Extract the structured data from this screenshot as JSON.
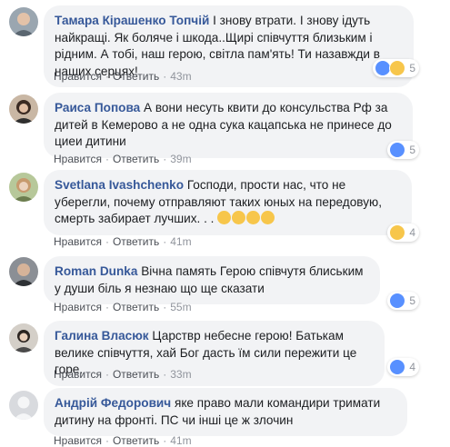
{
  "comments": [
    {
      "author": "Тамара Кірашенко Топчій",
      "text": "І знову втрати. І знову ідуть найкращі. Як боляче і шкода..Щирі співчуття близьким і рідним. А тобі, наш герою, світла пам'ять! Ти назавжди в наших серцях!",
      "like_label": "Нравится",
      "reply_label": "Ответить",
      "time": "43m",
      "reactions": [
        "like",
        "sad"
      ],
      "reaction_count": "5"
    },
    {
      "author": "Раиса Попова",
      "text": "А вони несуть квити до консульства Рф за дитей в Кемерово а не одна сука кацапська не принесе до циеи дитини",
      "like_label": "Нравится",
      "reply_label": "Ответить",
      "time": "39m",
      "reactions": [
        "like"
      ],
      "reaction_count": "5"
    },
    {
      "author": "Svetlana Ivashchenko",
      "text": "Господи, прости нас, что не уберегли, почему отправляют таких юных на передовую, смерть забирает лучших. . .",
      "emoji_count": 4,
      "like_label": "Нравится",
      "reply_label": "Ответить",
      "time": "41m",
      "reactions": [
        "sad"
      ],
      "reaction_count": "4"
    },
    {
      "author": "Roman Dunka",
      "text": "Вічна память Герою співчутя блиським у души біль я незнаю що ще сказати",
      "like_label": "Нравится",
      "reply_label": "Ответить",
      "time": "55m",
      "reactions": [
        "like"
      ],
      "reaction_count": "5"
    },
    {
      "author": "Галина Власюк",
      "text": "Царствр небесне герою! Батькам велике співчуття, хай Бог дасть їм сили пережити це горе.",
      "like_label": "Нравится",
      "reply_label": "Ответить",
      "time": "33m",
      "reactions": [
        "like"
      ],
      "reaction_count": "4"
    },
    {
      "author": "Андрій Федорович",
      "text": "яке право мали командири тримати дитину на фронті. ПС чи інші це ж злочин",
      "like_label": "Нравится",
      "reply_label": "Ответить",
      "time": "41m",
      "reactions": [],
      "reaction_count": ""
    }
  ],
  "colors": {
    "author": "#365899",
    "bubble": "#f2f3f5",
    "like": "#5890ff",
    "sad": "#f7c64b"
  }
}
